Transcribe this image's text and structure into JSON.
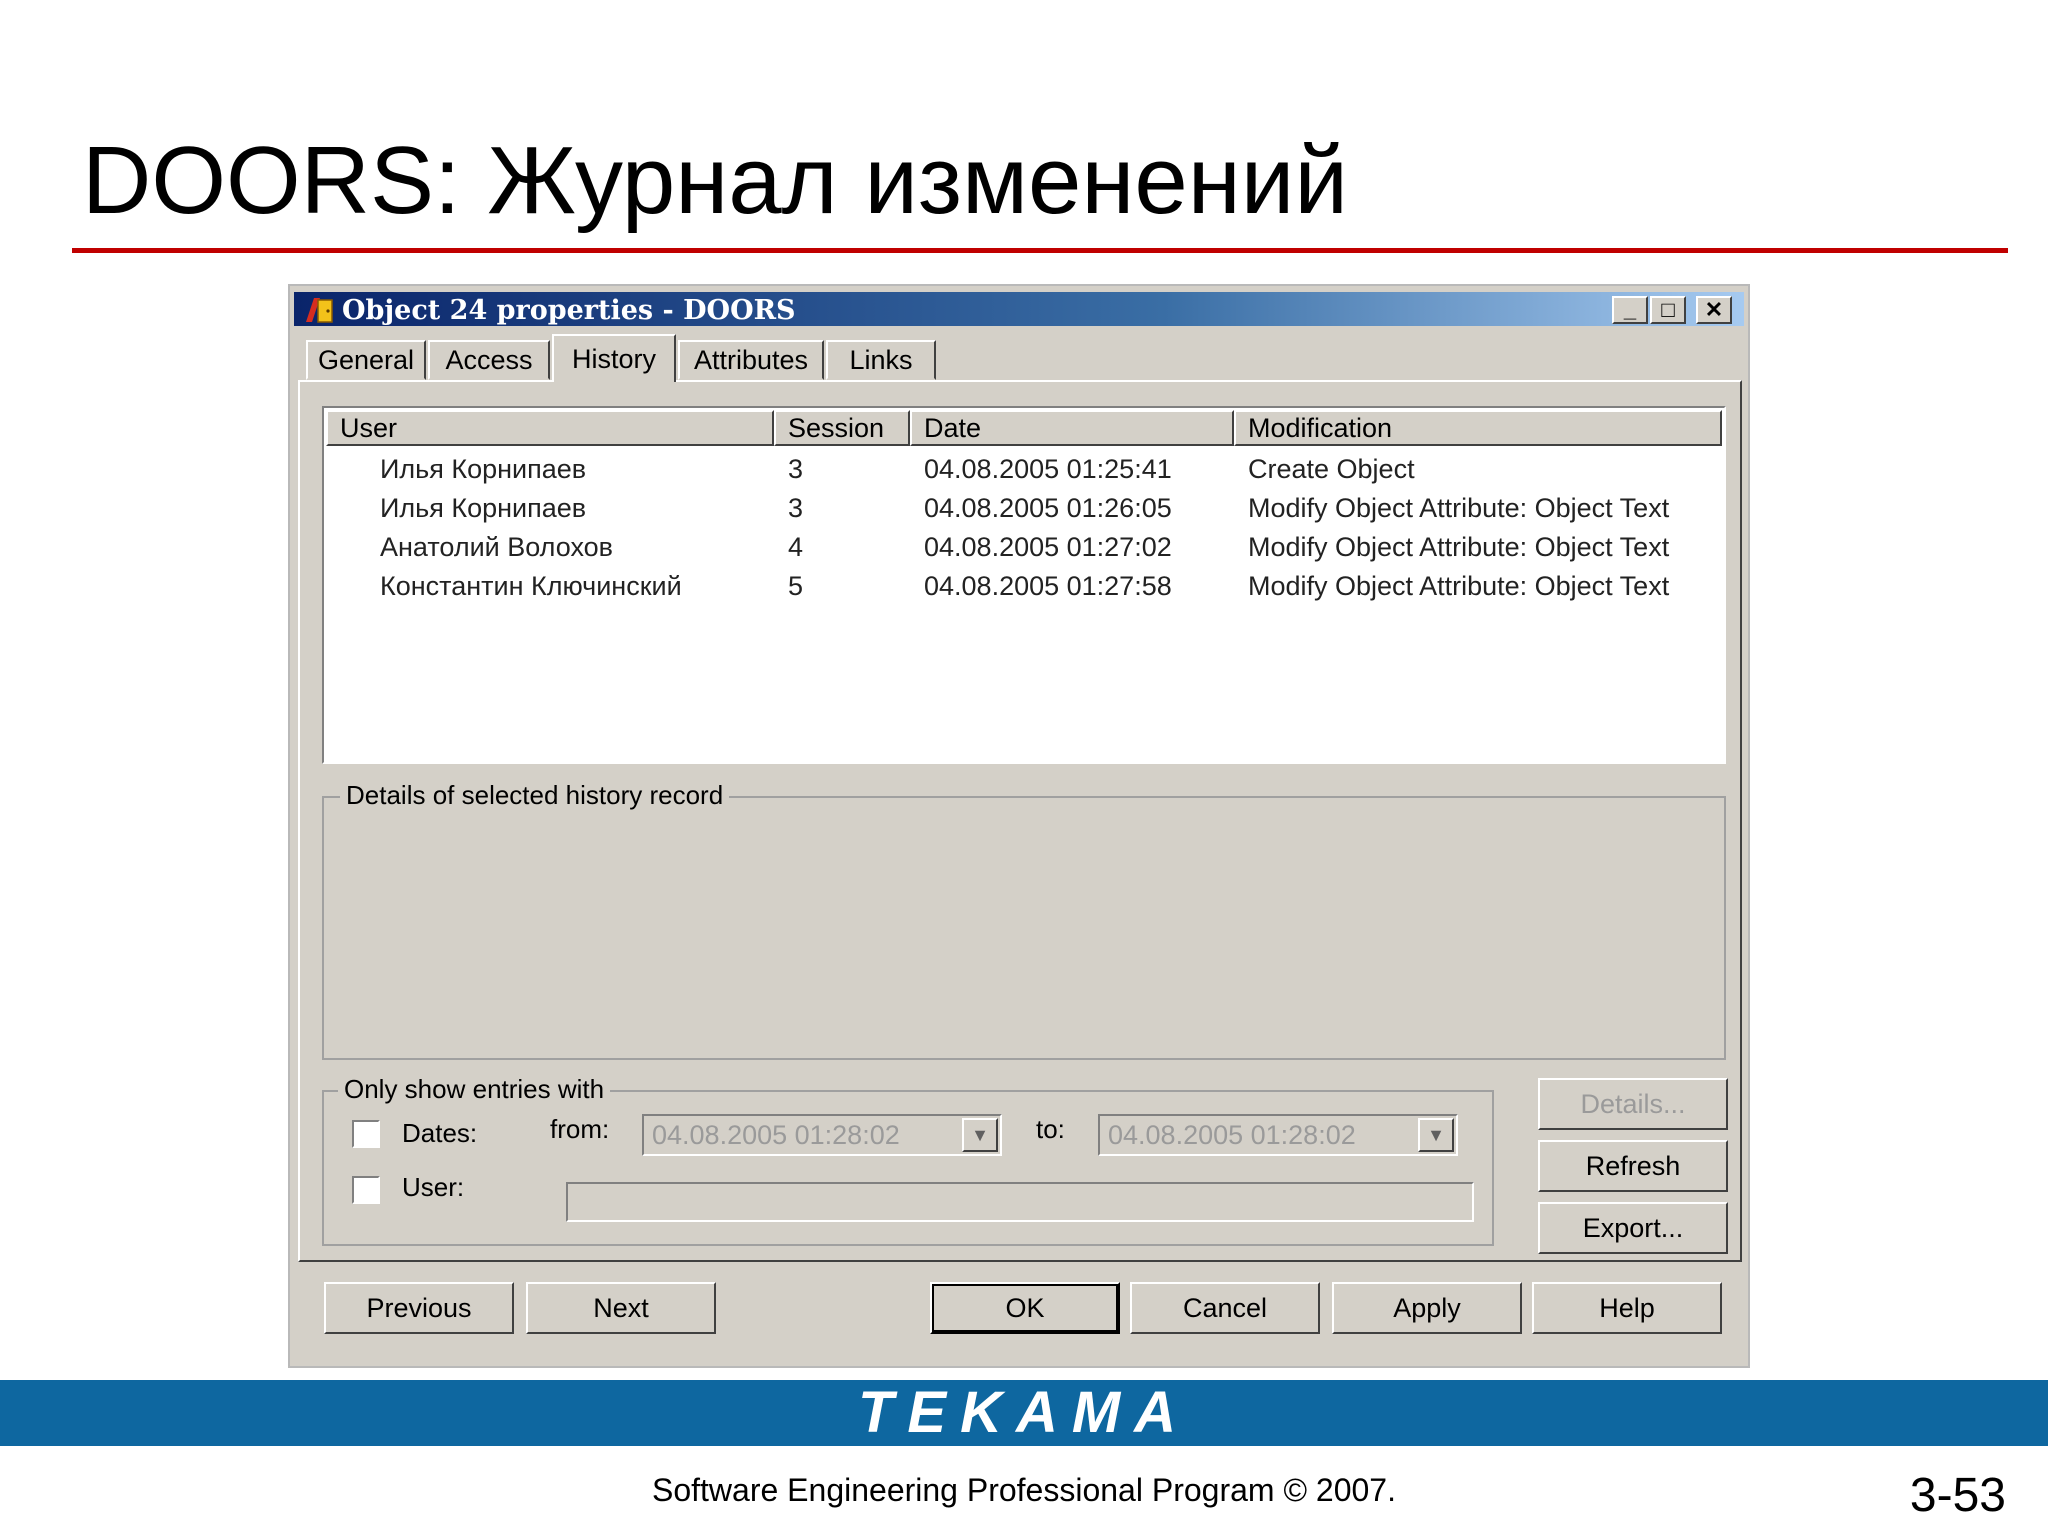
{
  "slide": {
    "title": "DOORS: Журнал изменений",
    "brand": "TEKAMA",
    "footer": "Software Engineering Professional Program © 2007.",
    "page_number": "3-53",
    "accent_color": "#c00000",
    "brand_color": "#0e67a0"
  },
  "window": {
    "title": "Object 24 properties - DOORS",
    "icon": "doors-app-icon",
    "controls": {
      "minimize": "_",
      "maximize": "□",
      "close": "✕"
    }
  },
  "tabs": [
    {
      "label": "General",
      "active": false
    },
    {
      "label": "Access",
      "active": false
    },
    {
      "label": "History",
      "active": true
    },
    {
      "label": "Attributes",
      "active": false
    },
    {
      "label": "Links",
      "active": false
    }
  ],
  "history": {
    "columns": [
      "User",
      "Session",
      "Date",
      "Modification"
    ],
    "rows": [
      {
        "user": "Илья Корнипаев",
        "session": "3",
        "date": "04.08.2005 01:25:41",
        "modification": "Create Object"
      },
      {
        "user": "Илья Корнипаев",
        "session": "3",
        "date": "04.08.2005 01:26:05",
        "modification": "Modify Object Attribute: Object Text"
      },
      {
        "user": "Анатолий Волохов",
        "session": "4",
        "date": "04.08.2005 01:27:02",
        "modification": "Modify Object Attribute: Object Text"
      },
      {
        "user": "Константин Ключинский",
        "session": "5",
        "date": "04.08.2005 01:27:58",
        "modification": "Modify Object Attribute: Object Text"
      }
    ]
  },
  "details": {
    "label": "Details of selected history record"
  },
  "filter": {
    "label": "Only show entries with",
    "dates_label": "Dates:",
    "from_label": "from:",
    "from_value": "04.08.2005 01:28:02",
    "to_label": "to:",
    "to_value": "04.08.2005 01:28:02",
    "user_label": "User:",
    "user_value": ""
  },
  "side_buttons": {
    "details": "Details...",
    "refresh": "Refresh",
    "export": "Export..."
  },
  "bottom_buttons": {
    "previous": "Previous",
    "next": "Next",
    "ok": "OK",
    "cancel": "Cancel",
    "apply": "Apply",
    "help": "Help"
  }
}
